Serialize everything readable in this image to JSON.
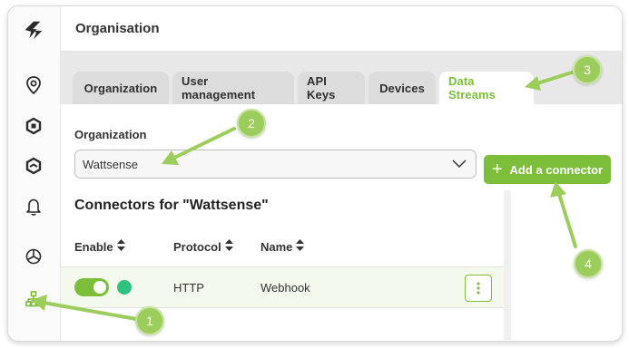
{
  "header": {
    "title": "Organisation"
  },
  "tabs": [
    {
      "label": "Organization",
      "active": false
    },
    {
      "label": "User management",
      "active": false
    },
    {
      "label": "API Keys",
      "active": false
    },
    {
      "label": "Devices",
      "active": false
    },
    {
      "label": "Data Streams",
      "active": true
    }
  ],
  "org_select": {
    "label": "Organization",
    "value": "Wattsense"
  },
  "add_connector": {
    "label": "Add a connector"
  },
  "connectors": {
    "title": "Connectors for \"Wattsense\"",
    "columns": [
      "Enable",
      "Protocol",
      "Name"
    ],
    "rows": [
      {
        "enabled": true,
        "status": "online",
        "protocol": "HTTP",
        "name": "Webhook"
      }
    ]
  },
  "sidebar": {
    "items": [
      {
        "icon": "logo-icon"
      },
      {
        "icon": "location-pin-icon"
      },
      {
        "icon": "hex-node-icon"
      },
      {
        "icon": "layers-icon"
      },
      {
        "icon": "bell-icon"
      },
      {
        "icon": "cubes-icon"
      },
      {
        "icon": "org-tree-icon"
      }
    ]
  },
  "annotations": [
    "1",
    "2",
    "3",
    "4"
  ],
  "colors": {
    "accent": "#7cbd3a",
    "status_online": "#2ec27e",
    "annotation": "#9ccc5c"
  }
}
